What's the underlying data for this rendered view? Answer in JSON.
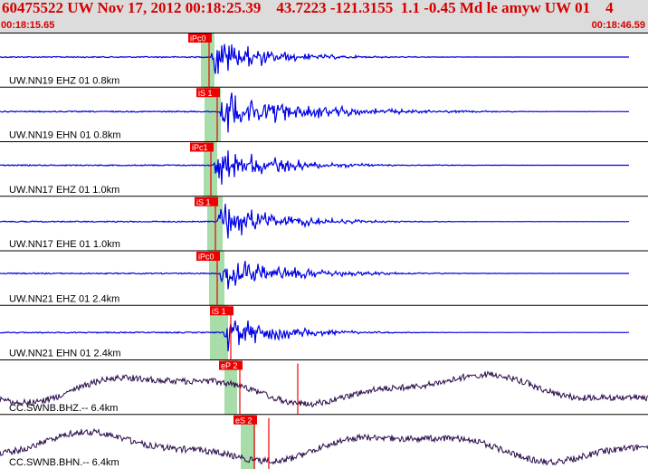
{
  "header": {
    "title": "60475522 UW Nov 17, 2012 00:18:25.39    43.7223 -121.3155  1.1 -0.45 Md le amyw UW 01    4",
    "time_start": "00:18:15.65",
    "time_end": "00:18:46.59"
  },
  "colors": {
    "header_bg": "#dcdcdc",
    "header_text": "#d40000",
    "trace_high_freq": "#0000e6",
    "trace_broadband": "#2a0a4a",
    "pick_marker": "#ee0000",
    "pick_window": "#a8dca8",
    "separator": "#000000"
  },
  "channels": [
    {
      "label": "UW.NN19 EHZ 01 0.8km",
      "pick": "iPc0",
      "trace": "high-freq"
    },
    {
      "label": "UW.NN19 EHN 01 0.8km",
      "pick": "iS 1",
      "trace": "high-freq"
    },
    {
      "label": "UW.NN17 EHZ 01 1.0km",
      "pick": "iPc1",
      "trace": "high-freq"
    },
    {
      "label": "UW.NN17 EHE 01 1.0km",
      "pick": "iS 1",
      "trace": "high-freq"
    },
    {
      "label": "UW.NN21 EHZ 01 2.4km",
      "pick": "iPc0",
      "trace": "high-freq"
    },
    {
      "label": "UW.NN21 EHN 01 2.4km",
      "pick": "iS 1",
      "trace": "high-freq"
    },
    {
      "label": "CC.SWNB.BHZ.-- 6.4km",
      "pick": "eP 2",
      "trace": "broadband"
    },
    {
      "label": "CC.SWNB.BHN.-- 6.4km",
      "pick": "eS 2",
      "trace": "broadband"
    }
  ]
}
